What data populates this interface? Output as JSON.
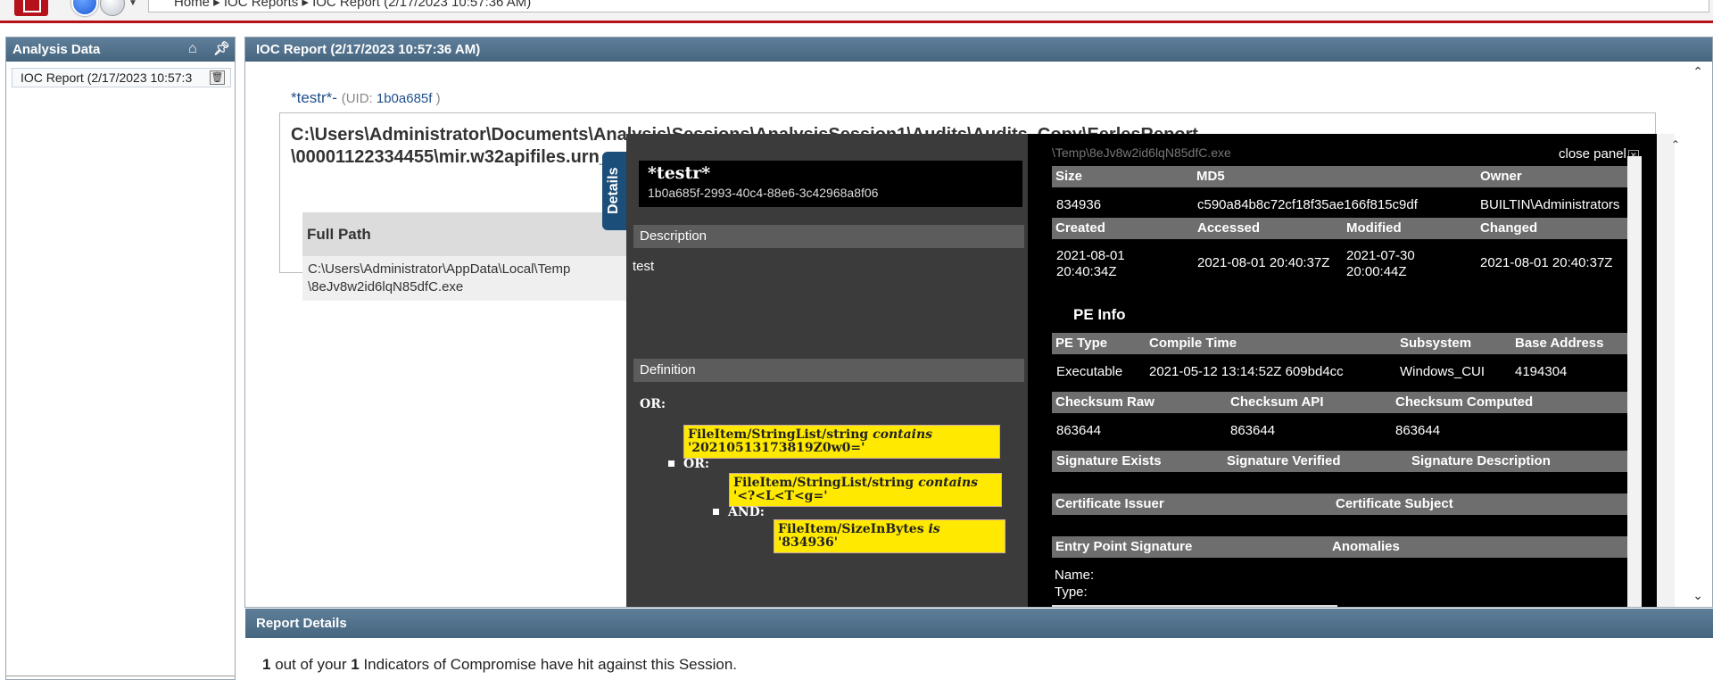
{
  "topbar": {
    "breadcrumb": "Home ▸ IOC Reports ▸ IOC Report (2/17/2023 10:57:36 AM)"
  },
  "left_panel": {
    "title": "Analysis Data",
    "items": [
      {
        "label": "IOC Report (2/17/2023 10:57:3"
      }
    ]
  },
  "main": {
    "header": "IOC Report (2/17/2023 10:57:36 AM)",
    "indicator": {
      "name": "*testr*-",
      "uid_label": "(UID: ",
      "uid": "1b0a685f",
      "uid_close": " )"
    },
    "result": {
      "path_line1": "C:\\Users\\Administrator\\Documents\\Analysis\\Sessions\\AnalysisSession1\\Audits\\Audits_Copy\\EerlesReport",
      "path_line2": "\\00001122334455\\mir.w32apifiles.urn_...",
      "table_header": "Full Path",
      "table_value": "C:\\Users\\Administrator\\AppData\\Local\\Temp\\8eJv8w2id6lqN85dfC.exe"
    }
  },
  "report_details": {
    "header": "Report Details",
    "hit_count": "1",
    "text_mid": " out of your ",
    "total": "1",
    "text_end": " Indicators of Compromise have hit against this Session."
  },
  "details_panel": {
    "tab_label": "Details",
    "title": "*testr*",
    "uid": "1b0a685f-2993-40c4-88e6-3c42968a8f06",
    "description_label": "Description",
    "description": "test",
    "definition_label": "Definition",
    "or_label": "OR:",
    "or2_label": "OR:",
    "and_label": "AND:",
    "conditions": [
      {
        "field": "FileItem/StringList/string ",
        "op": "contains",
        "value": " '20210513173819Z0w0='"
      },
      {
        "field": "FileItem/StringList/string ",
        "op": "contains",
        "value": " '<?<L<T<g='"
      },
      {
        "field": "FileItem/SizeInBytes ",
        "op": "is",
        "value": " '834936'"
      }
    ]
  },
  "file_panel": {
    "close_label": "close panel",
    "clip_text": "\\Temp\\8eJv8w2id6lqN85dfC.exe",
    "size_header": "Size",
    "md5_header": "MD5",
    "owner_header": "Owner",
    "size": "834936",
    "md5": "c590a84b8c72cf18f35ae166f815c9df",
    "owner": "BUILTIN\\Administrators",
    "created_header": "Created",
    "accessed_header": "Accessed",
    "modified_header": "Modified",
    "changed_header": "Changed",
    "created_l1": "2021-08-01",
    "created_l2": "20:40:34Z",
    "accessed": "2021-08-01 20:40:37Z",
    "modified_l1": "2021-07-30",
    "modified_l2": "20:00:44Z",
    "changed": "2021-08-01 20:40:37Z",
    "pe_info_title": "PE Info",
    "pe_type_header": "PE Type",
    "compile_time_header": "Compile Time",
    "subsystem_header": "Subsystem",
    "base_address_header": "Base Address",
    "pe_type": "Executable",
    "compile_time": "2021-05-12 13:14:52Z 609bd4cc",
    "subsystem": "Windows_CUI",
    "base_address": "4194304",
    "checksum_raw_header": "Checksum Raw",
    "checksum_api_header": "Checksum API",
    "checksum_computed_header": "Checksum Computed",
    "checksum_raw": "863644",
    "checksum_api": "863644",
    "checksum_computed": "863644",
    "sig_exists_header": "Signature Exists",
    "sig_verified_header": "Signature Verified",
    "sig_desc_header": "Signature Description",
    "cert_issuer_header": "Certificate Issuer",
    "cert_subject_header": "Certificate Subject",
    "entry_point_header": "Entry Point Signature",
    "anomalies_header": "Anomalies",
    "name_label": "Name:",
    "type_label": "Type:"
  },
  "colors": {
    "header_bar": "#46657f",
    "brand_red": "#b5121b",
    "highlight": "#ffe900",
    "details_tab": "#1c4e7a"
  }
}
